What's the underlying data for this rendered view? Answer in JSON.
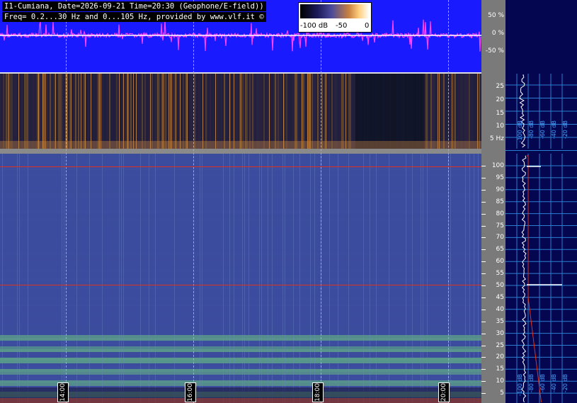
{
  "header": {
    "line1": "I1-Cumiana, Date=2026-09-21 Time=20:30 (Geophone/E-field))",
    "line2": "Freq= 0.2...30 Hz and 0...105 Hz, provided by www.vlf.it ©"
  },
  "colorbar": {
    "min_label": "-100 dB",
    "mid_label": "-50",
    "max_label": "0"
  },
  "waveform_axis": {
    "ticks": [
      "50 %",
      "0 %",
      "-50 %"
    ]
  },
  "geophone_axis": {
    "ticks": [
      "25",
      "20",
      "15",
      "10",
      "5 Hz"
    ]
  },
  "efield_axis": {
    "ticks": [
      "100",
      "95",
      "90",
      "85",
      "80",
      "75",
      "70",
      "65",
      "60",
      "55",
      "50",
      "45",
      "40",
      "35",
      "30",
      "25",
      "20",
      "15",
      "10",
      "5"
    ]
  },
  "time_labels": [
    "14:00",
    "16:00",
    "18:00",
    "20:00"
  ],
  "profile_labels_top": [
    "-100 dB",
    "-80 dB",
    "-60 dB",
    "-40 dB",
    "-20 dB"
  ],
  "profile_labels_bottom": [
    "-100 dB",
    "-80 dB",
    "-60 dB",
    "-40 dB",
    "-20 dB"
  ],
  "colors": {
    "waveform_bg": "#1a1aff",
    "waveform_trace": "#ff40ff",
    "grid": "#2a7fd0",
    "marker_line": "#e03020"
  }
}
